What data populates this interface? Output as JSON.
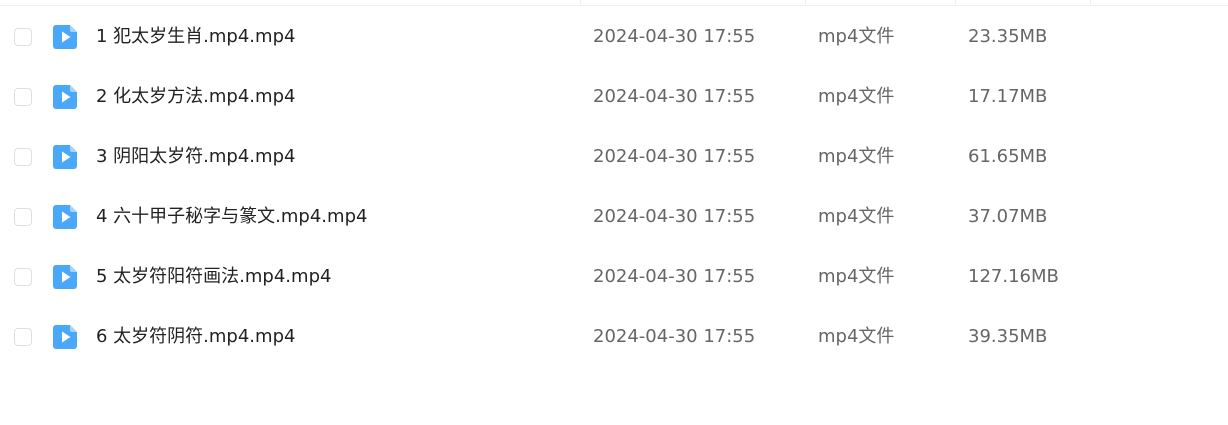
{
  "files": [
    {
      "name": "1 犯太岁生肖.mp4.mp4",
      "date": "2024-04-30 17:55",
      "type": "mp4文件",
      "size": "23.35MB",
      "icon": "video-file-icon"
    },
    {
      "name": "2 化太岁方法.mp4.mp4",
      "date": "2024-04-30 17:55",
      "type": "mp4文件",
      "size": "17.17MB",
      "icon": "video-file-icon"
    },
    {
      "name": "3 阴阳太岁符.mp4.mp4",
      "date": "2024-04-30 17:55",
      "type": "mp4文件",
      "size": "61.65MB",
      "icon": "video-file-icon"
    },
    {
      "name": "4 六十甲子秘字与篆文.mp4.mp4",
      "date": "2024-04-30 17:55",
      "type": "mp4文件",
      "size": "37.07MB",
      "icon": "video-file-icon"
    },
    {
      "name": "5 太岁符阳符画法.mp4.mp4",
      "date": "2024-04-30 17:55",
      "type": "mp4文件",
      "size": "127.16MB",
      "icon": "video-file-icon"
    },
    {
      "name": "6 太岁符阴符.mp4.mp4",
      "date": "2024-04-30 17:55",
      "type": "mp4文件",
      "size": "39.35MB",
      "icon": "video-file-icon"
    }
  ],
  "colors": {
    "icon_blue": "#4aa8fb",
    "icon_fold": "#a7d3fd",
    "name_text": "#222222",
    "meta_text": "#666666",
    "divider": "#eef0f3",
    "checkbox_border": "#dcdfe6"
  }
}
